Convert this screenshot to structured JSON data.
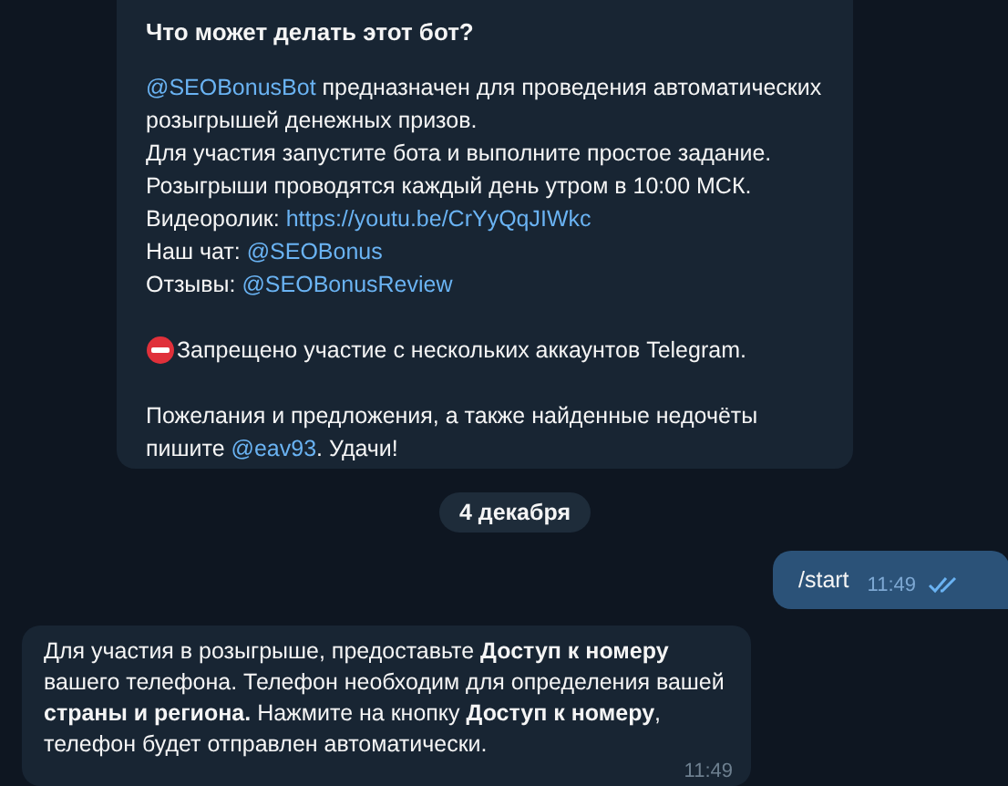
{
  "bot_info": {
    "title": "Что может делать этот бот?",
    "paragraphs": [
      [
        [
          {
            "kind": "link",
            "text": "@SEOBonusBot"
          },
          {
            "kind": "text",
            "text": " предназначен для проведения автоматических"
          }
        ],
        [
          {
            "kind": "text",
            "text": "розыгрышей денежных призов."
          }
        ],
        [
          {
            "kind": "text",
            "text": "Для участия запустите бота и выполните простое задание."
          }
        ],
        [
          {
            "kind": "text",
            "text": "Розыгрыши проводятся каждый день утром в 10:00 МСК."
          }
        ],
        [
          {
            "kind": "text",
            "text": "Видеоролик: "
          },
          {
            "kind": "link",
            "text": "https://youtu.be/CrYyQqJIWkc"
          }
        ],
        [
          {
            "kind": "text",
            "text": "Наш чат: "
          },
          {
            "kind": "link",
            "text": "@SEOBonus"
          }
        ],
        [
          {
            "kind": "text",
            "text": "Отзывы: "
          },
          {
            "kind": "link",
            "text": "@SEOBonusReview"
          }
        ]
      ],
      [
        [
          {
            "kind": "icon"
          },
          {
            "kind": "text",
            "text": "Запрещено участие с нескольких аккаунтов Telegram."
          }
        ]
      ],
      [
        [
          {
            "kind": "text",
            "text": "Пожелания и предложения, а также найденные недочёты"
          }
        ],
        [
          {
            "kind": "text",
            "text": "пишите "
          },
          {
            "kind": "link",
            "text": "@eav93"
          },
          {
            "kind": "text",
            "text": ". Удачи!"
          }
        ]
      ]
    ]
  },
  "date_separator": "4 декабря",
  "messages": [
    {
      "kind": "outgoing",
      "text": "/start",
      "time": "11:49",
      "read": true
    },
    {
      "kind": "incoming",
      "text": "Для участия в розыгрыше, предоставьте **Доступ к номеру** вашего телефона. Телефон необходим для определения вашей **страны и региона.** Нажмите на кнопку **Доступ к номеру**, телефон будет отправлен автоматически.",
      "time": "11:49"
    }
  ]
}
